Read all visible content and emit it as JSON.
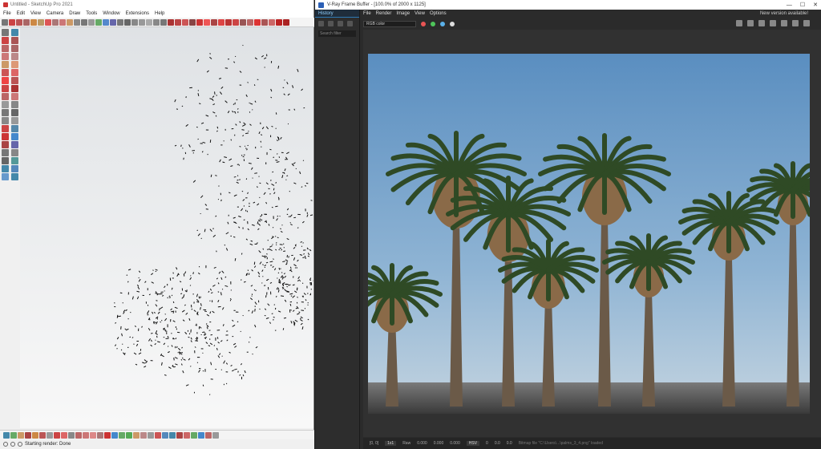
{
  "sketchup": {
    "title": "Untitled - SketchUp Pro 2021",
    "menu": [
      "File",
      "Edit",
      "View",
      "Camera",
      "Draw",
      "Tools",
      "Window",
      "Extensions",
      "Help"
    ],
    "status_text": "Starting render: Done"
  },
  "vray": {
    "title": "V-Ray Frame Buffer - [100.0% of 2000 x 1125]",
    "history_tab": "History",
    "search_placeholder": "Search filter",
    "menu": [
      "File",
      "Render",
      "Image",
      "View",
      "Options"
    ],
    "new_version": "New version available!",
    "channel": "RGB color",
    "dot_colors": [
      "#e85454",
      "#4ec45a",
      "#5ab0e8",
      "#dddddd"
    ],
    "status": {
      "coords": "[0, 0]",
      "zoom": "1x1",
      "raw_label": "Raw",
      "raw_values": [
        "0.000",
        "0.000",
        "0.000"
      ],
      "mode": "HSV",
      "v1": "0",
      "v2": "0.0",
      "v3": "0.0",
      "message": "Bitmap file \"C:\\Users\\...\\palms_3_4.png\" loaded"
    }
  },
  "colors": {
    "sky_top": "#5a8ec0",
    "sky_bottom": "#c4d4e0",
    "palm_green": "#2f4a25"
  }
}
